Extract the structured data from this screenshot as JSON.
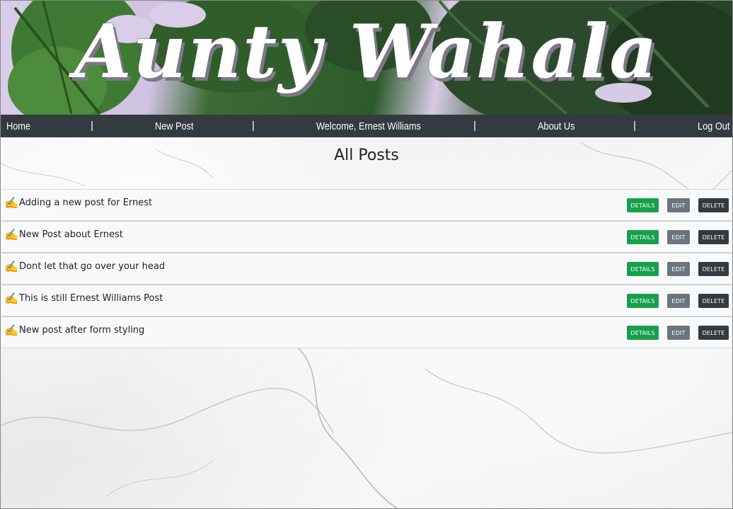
{
  "header": {
    "brand": "Aunty Wahala"
  },
  "nav": {
    "items": [
      {
        "label": "Home"
      },
      {
        "label": "New Post"
      },
      {
        "label": "Welcome, Ernest Williams"
      },
      {
        "label": "About Us"
      },
      {
        "label": "Log Out"
      }
    ],
    "separator": "|"
  },
  "main": {
    "title": "All Posts",
    "posts": [
      {
        "icon": "writing-hand-icon",
        "title": "Adding a new post for Ernest"
      },
      {
        "icon": "writing-hand-icon",
        "title": "New Post about Ernest"
      },
      {
        "icon": "writing-hand-icon",
        "title": "Dont let that go over your head"
      },
      {
        "icon": "writing-hand-icon",
        "title": "This is still Ernest Williams Post"
      },
      {
        "icon": "writing-hand-icon",
        "title": "New post after form styling"
      }
    ],
    "actions": {
      "details": "DETAILS",
      "edit": "EDIT",
      "delete": "DELETE"
    },
    "pen_glyph": "✍"
  },
  "colors": {
    "nav_bg": "#343a40",
    "details": "#17a04a",
    "edit": "#6c757d",
    "delete": "#343a40",
    "row_bg": "#f8f9fa"
  }
}
